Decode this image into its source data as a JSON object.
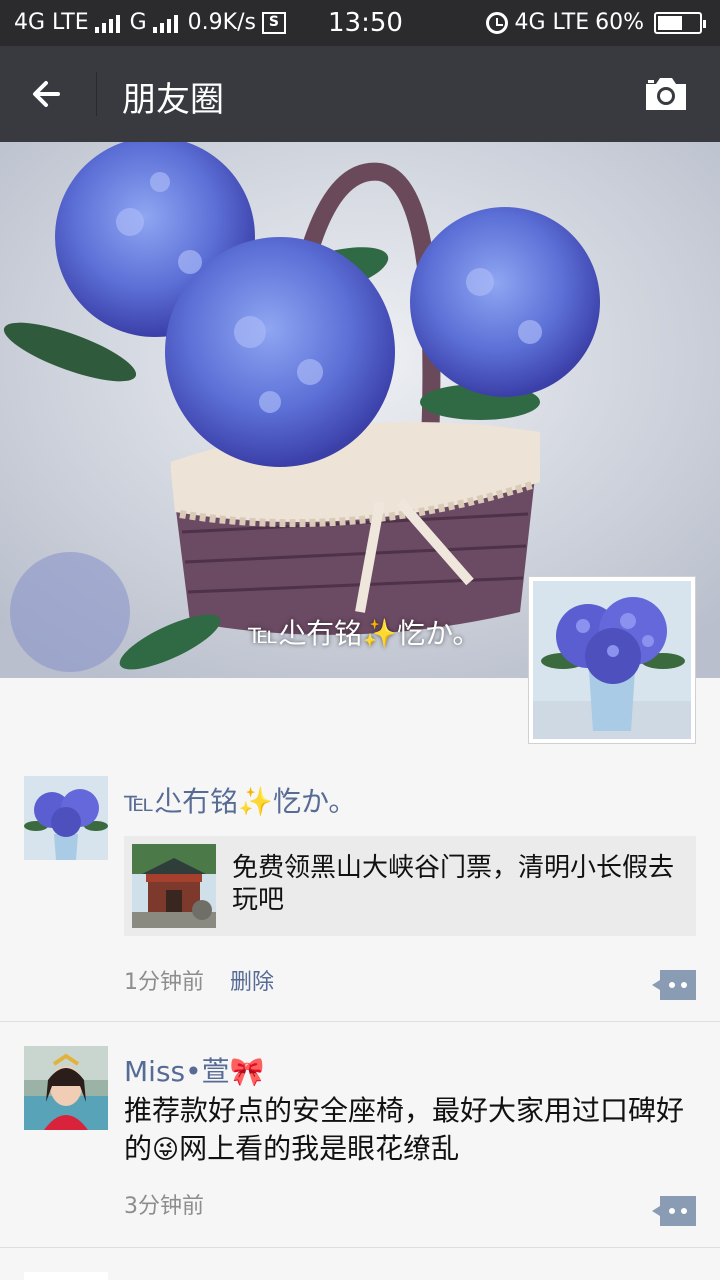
{
  "status_bar": {
    "net1": "4G LTE",
    "net2": "G",
    "speed": "0.9K/s",
    "screenshot_label": "S",
    "time": "13:50",
    "net3": "4G LTE",
    "battery": "60%",
    "battery_level": 0.6
  },
  "nav": {
    "title": "朋友圈"
  },
  "cover": {
    "owner_name": "℡尐冇铭✨忔か。"
  },
  "posts": [
    {
      "name": "℡尐冇铭✨忔か。",
      "share_title": "免费领黑山大峡谷门票，清明小长假去玩吧",
      "time": "1分钟前",
      "delete_label": "删除"
    },
    {
      "name": "Miss•萱🎀",
      "text_before": "推荐款好点的安全座椅，最好大家用过口碑好的",
      "emoji": "😜",
      "text_after": "网上看的我是眼花缭乱",
      "time": "3分钟前"
    }
  ],
  "colors": {
    "status_bg": "#2b2b2d",
    "nav_bg": "#393a3f",
    "link": "#576b95",
    "page_bg": "#f6f6f6"
  }
}
